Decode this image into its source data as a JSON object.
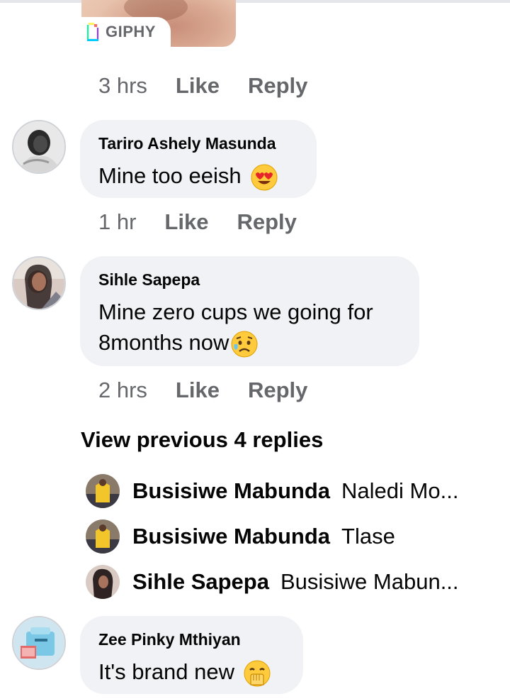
{
  "gif": {
    "badge": "GIPHY",
    "time": "3 hrs"
  },
  "actions": {
    "like": "Like",
    "reply": "Reply"
  },
  "comments": [
    {
      "author": "Tariro Ashely Masunda",
      "text": "Mine too eeish",
      "emoji": "heart-eyes-emoji",
      "time": "1 hr"
    },
    {
      "author": "Sihle Sapepa",
      "text_line1": "Mine zero cups we going for",
      "text_line2": "8months now",
      "emoji": "sad-relieved-emoji",
      "time": "2 hrs"
    },
    {
      "author": "Zee Pinky Mthiyan",
      "text": "It's brand new",
      "emoji": "hand-over-mouth-emoji"
    }
  ],
  "view_previous": "View previous 4 replies",
  "replies": [
    {
      "name": "Busisiwe Mabunda",
      "text": "Naledi Mo..."
    },
    {
      "name": "Busisiwe Mabunda",
      "text": "Tlase"
    },
    {
      "name": "Sihle Sapepa",
      "text": "Busisiwe Mabun..."
    }
  ],
  "colors": {
    "bubble": "#f0f2f5",
    "meta": "#65676b",
    "text": "#050505"
  }
}
